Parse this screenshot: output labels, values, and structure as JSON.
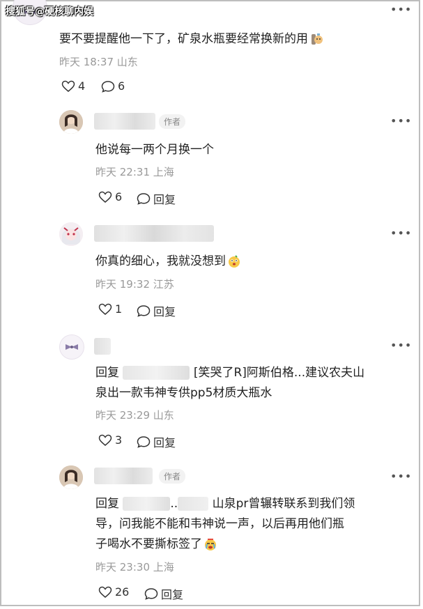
{
  "watermark": "搜狐号@硬核聊内娱",
  "comments": [
    {
      "text": "要不要提醒他一下了，矿泉水瓶要经常换新的用",
      "time": "昨天 18:37",
      "location": "山东",
      "likes": "4",
      "replies": "6"
    },
    {
      "author_tag": "作者",
      "text": "他说每一两个月换一个",
      "time": "昨天 22:31",
      "location": "上海",
      "likes": "6",
      "reply_label": "回复"
    },
    {
      "text": "你真的细心，我就没想到",
      "time": "昨天 19:32",
      "location": "江苏",
      "likes": "1",
      "reply_label": "回复"
    },
    {
      "reply_prefix": "回复",
      "line1": "[笑哭了R]阿斯伯格...建议农夫山",
      "line2": "泉出一款韦神专供pp5材质大瓶水",
      "time": "昨天 23:29",
      "location": "山东",
      "likes": "3",
      "reply_label": "回复"
    },
    {
      "author_tag": "作者",
      "reply_prefix": "回复",
      "line1_part": "..",
      "line1": "山泉pr曾辗转联系到我们领",
      "line2": "导，问我能不能和韦神说一声，以后再用他们瓶",
      "line3": "子喝水不要撕标签了",
      "time": "昨天 23:30",
      "location": "上海",
      "likes": "26",
      "reply_label": "回复"
    }
  ],
  "icons": {
    "like": "heart-icon",
    "comment": "comment-bubble-icon",
    "more": "more-dots-icon"
  }
}
